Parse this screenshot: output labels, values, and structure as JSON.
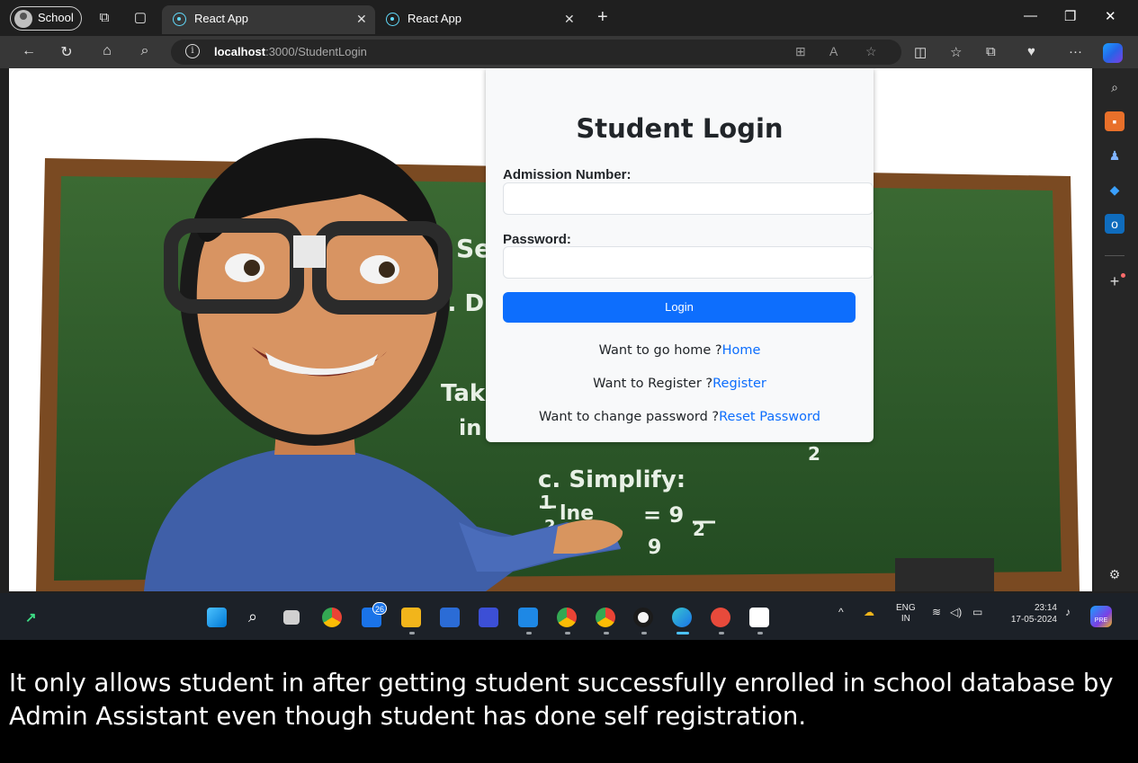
{
  "browser": {
    "profile_label": "School",
    "tabs": [
      {
        "title": "React App",
        "active": true
      },
      {
        "title": "React App",
        "active": false
      }
    ],
    "address": {
      "host": "localhost",
      "path": ":3000/StudentLogin"
    }
  },
  "login": {
    "heading": "Student Login",
    "admission_label": "Admission Number:",
    "admission_value": "",
    "password_label": "Password:",
    "password_value": "",
    "button_label": "Login",
    "home_prompt": "Want to go home ?",
    "home_link": "Home",
    "register_prompt": "Want to Register ?",
    "register_link": "Register",
    "reset_prompt": "Want to change password ?",
    "reset_link": "Reset Password"
  },
  "background_art": {
    "chalk_text": [
      "Se",
      "a. D",
      "Tak",
      "in",
      "c. Simplify:",
      "1",
      "lne",
      "= 9",
      "2",
      "2",
      "9",
      "2"
    ]
  },
  "taskbar": {
    "badge_mail": "26",
    "language": "ENG",
    "region": "IN",
    "time": "23:14",
    "date": "17-05-2024",
    "copilot_badge": "PRE"
  },
  "caption": "It only allows student in after getting student successfully enrolled in school database by Admin Assistant even though student has done self registration.",
  "colors": {
    "primary_button": "#0d6efd",
    "link": "#0d6efd",
    "chalkboard": "#2e5e2a",
    "board_frame": "#7a4a22"
  }
}
